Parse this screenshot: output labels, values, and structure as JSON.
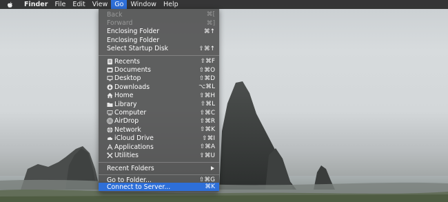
{
  "menubar": {
    "app": "Finder",
    "items": [
      "File",
      "Edit",
      "View",
      "Go",
      "Window",
      "Help"
    ],
    "active": "Go"
  },
  "go_menu": {
    "top_items": [
      {
        "label": "Back",
        "shortcut": "⌘[",
        "enabled": false
      },
      {
        "label": "Forward",
        "shortcut": "⌘]",
        "enabled": false
      },
      {
        "label": "Enclosing Folder",
        "shortcut": "⌘↑",
        "enabled": true
      },
      {
        "label": "Enclosing Folder",
        "shortcut": "",
        "enabled": true
      },
      {
        "label": "Select Startup Disk",
        "shortcut": "⇧⌘↑",
        "enabled": true
      }
    ],
    "places": [
      {
        "label": "Recents",
        "shortcut": "⇧⌘F",
        "icon": "recents-icon"
      },
      {
        "label": "Documents",
        "shortcut": "⇧⌘O",
        "icon": "documents-icon"
      },
      {
        "label": "Desktop",
        "shortcut": "⇧⌘D",
        "icon": "desktop-icon"
      },
      {
        "label": "Downloads",
        "shortcut": "⌥⌘L",
        "icon": "downloads-icon"
      },
      {
        "label": "Home",
        "shortcut": "⇧⌘H",
        "icon": "home-icon"
      },
      {
        "label": "Library",
        "shortcut": "⇧⌘L",
        "icon": "library-icon"
      },
      {
        "label": "Computer",
        "shortcut": "⇧⌘C",
        "icon": "computer-icon"
      },
      {
        "label": "AirDrop",
        "shortcut": "⇧⌘R",
        "icon": "airdrop-icon"
      },
      {
        "label": "Network",
        "shortcut": "⇧⌘K",
        "icon": "network-icon"
      },
      {
        "label": "iCloud Drive",
        "shortcut": "⇧⌘I",
        "icon": "icloud-icon"
      },
      {
        "label": "Applications",
        "shortcut": "⇧⌘A",
        "icon": "applications-icon"
      },
      {
        "label": "Utilities",
        "shortcut": "⇧⌘U",
        "icon": "utilities-icon"
      }
    ],
    "recent_folders": {
      "label": "Recent Folders"
    },
    "bottom_items": [
      {
        "label": "Go to Folder...",
        "shortcut": "⇧⌘G",
        "highlighted": false
      },
      {
        "label": "Connect to Server...",
        "shortcut": "⌘K",
        "highlighted": true
      }
    ]
  },
  "colors": {
    "highlight": "#2e6fd8",
    "menu_bg": "#4b4b4b",
    "menubar_bg": "#282828"
  }
}
